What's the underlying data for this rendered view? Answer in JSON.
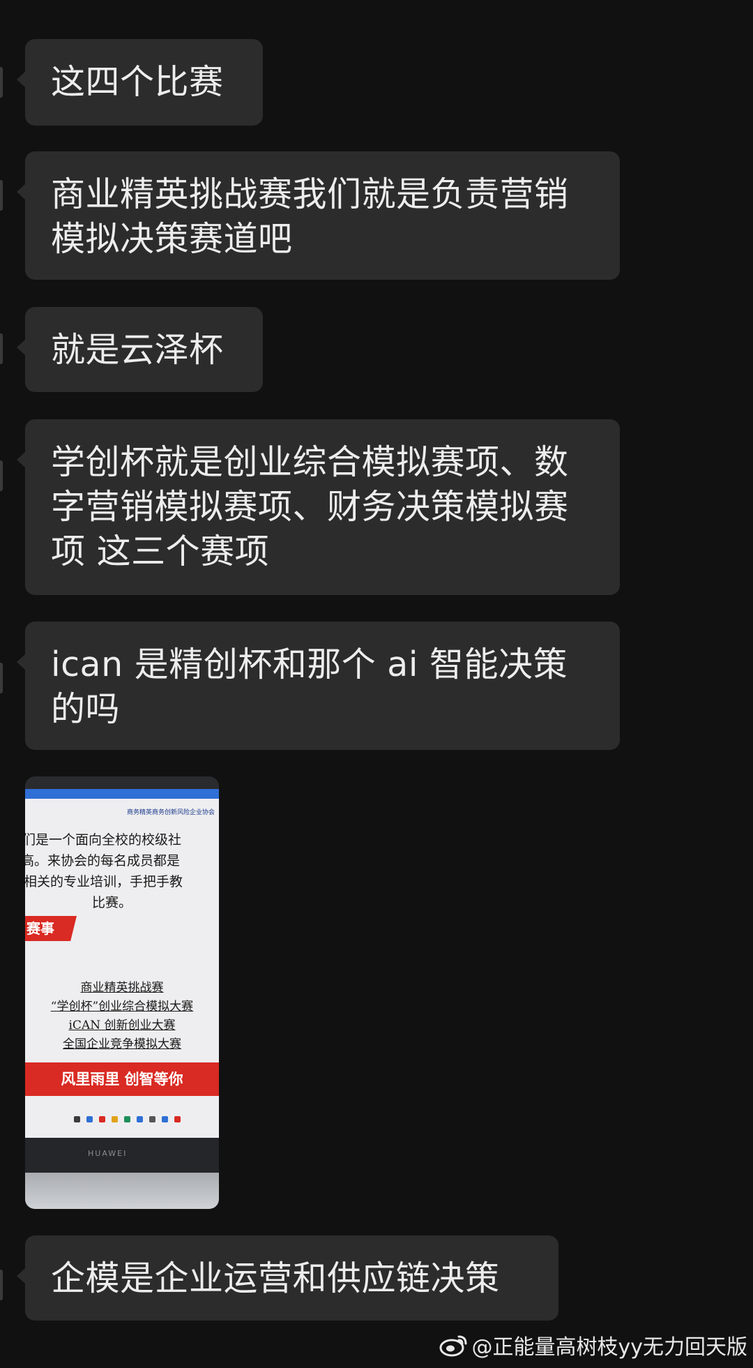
{
  "messages": [
    {
      "type": "text",
      "lines": [
        "这四个比赛"
      ]
    },
    {
      "type": "text",
      "lines": [
        "商业精英挑战赛我们就是负责营销",
        "模拟决策赛道吧"
      ]
    },
    {
      "type": "text",
      "lines": [
        "就是云泽杯"
      ]
    },
    {
      "type": "text",
      "lines": [
        "学创杯就是创业综合模拟赛项、数",
        "字营销模拟赛项、财务决策模拟赛",
        "项 这三个赛项"
      ]
    },
    {
      "type": "text",
      "lines": [
        "ican 是精创杯和那个 ai 智能决策",
        "的吗"
      ]
    },
    {
      "type": "image",
      "photo": {
        "header": "商务精英商务创新风险企业协会",
        "intro": [
          "们是一个面向全校的校级社",
          "高。来协会的每名成员都是",
          "相关的专业培训，手把手教",
          "比赛。"
        ],
        "section_tag": "赛事",
        "competitions": [
          "商业精英挑战赛",
          "“学创杯”创业综合模拟大赛",
          "iCAN 创新创业大赛",
          "全国企业竞争模拟大赛"
        ],
        "slogan": "风里雨里  创智等你",
        "laptop_brand": "HUAWEI"
      }
    },
    {
      "type": "text",
      "lines": [
        "企模是企业运营和供应链决策"
      ]
    }
  ],
  "watermark": {
    "icon": "weibo-icon",
    "text": "@正能量高树枝yy无力回天版"
  },
  "colors": {
    "background": "#111111",
    "bubble": "#2c2c2c",
    "text": "#ededed",
    "banner_red": "#d92a23"
  }
}
